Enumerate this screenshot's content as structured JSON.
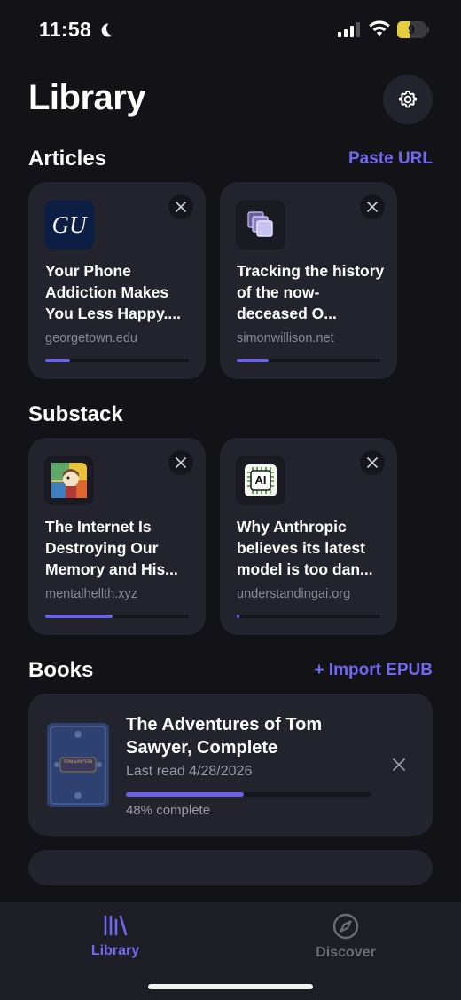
{
  "status_bar": {
    "time": "11:58",
    "battery": "9",
    "battery_level": 0.45
  },
  "header": {
    "title": "Library"
  },
  "articles": {
    "title": "Articles",
    "action": "Paste URL",
    "items": [
      {
        "title": "Your Phone Addiction Makes You Less Happy....",
        "domain": "georgetown.edu",
        "progress": 0.17,
        "icon": "georgetown-logo-icon",
        "logo_text": "GU"
      },
      {
        "title": "Tracking the history of the now-deceased O...",
        "domain": "simonwillison.net",
        "progress": 0.22,
        "icon": "stacked-squares-icon"
      }
    ]
  },
  "substack": {
    "title": "Substack",
    "items": [
      {
        "title": "The Internet Is Destroying Our Memory and His...",
        "domain": "mentalhellth.xyz",
        "progress": 0.47,
        "icon": "colorful-portrait-icon"
      },
      {
        "title": "Why Anthropic believes its latest model is too dan...",
        "domain": "understandingai.org",
        "progress": 0.02,
        "icon": "ai-chip-icon",
        "logo_text": "AI"
      }
    ]
  },
  "books": {
    "title": "Books",
    "action": "+ Import EPUB",
    "items": [
      {
        "title": "The Adventures of Tom Sawyer, Complete",
        "last_read": "Last read 4/28/2026",
        "progress": 0.48,
        "progress_label": "48% complete",
        "cover_text": "TOM SAWYER"
      }
    ]
  },
  "tabs": [
    {
      "label": "Library",
      "icon": "library-icon",
      "active": true
    },
    {
      "label": "Discover",
      "icon": "compass-icon",
      "active": false
    }
  ],
  "colors": {
    "accent": "#6a61e6",
    "accent_text": "#7168f0",
    "background": "#121217",
    "card": "#23232e",
    "inactive": "#6c6c78"
  }
}
